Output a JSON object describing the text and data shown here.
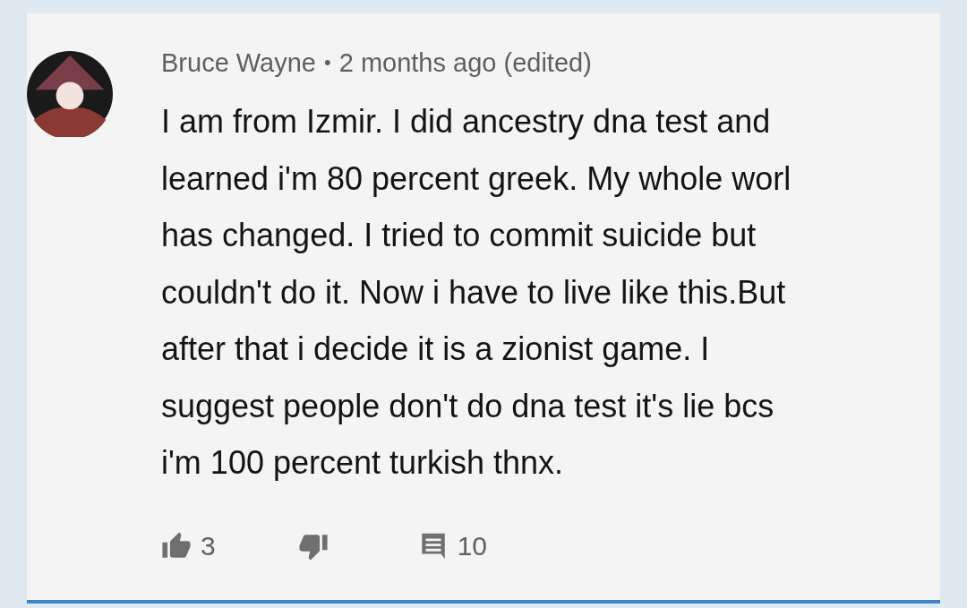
{
  "comment": {
    "author": "Bruce Wayne",
    "separator": "•",
    "time": "2 months ago (edited)",
    "body_lines": [
      "I am from Izmir. I did ancestry dna test and",
      "learned i'm 80 percent greek. My whole worl",
      "has changed. I tried to commit suicide but",
      "couldn't do it. Now i have to live like this.But",
      "after that i decide it is a zionist game. I",
      "suggest people don't do dna test it's lie bcs",
      "i'm 100 percent turkish thnx."
    ],
    "likes": "3",
    "replies": "10"
  }
}
